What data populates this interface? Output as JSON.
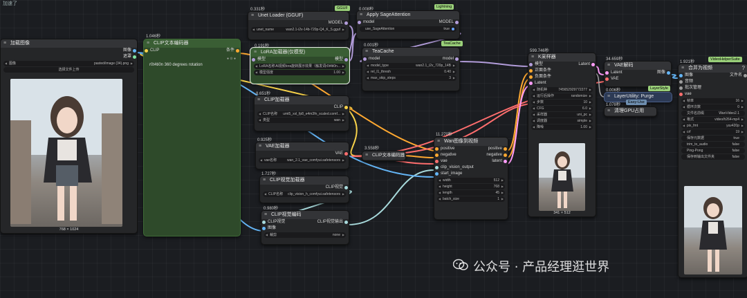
{
  "top_left_text": "加速了",
  "colors": {
    "clip": "#f7d24a",
    "model": "#b39ddb",
    "vae": "#ff6e6e",
    "conditioning": "#ffa931",
    "image": "#64b5f6",
    "latent": "#ff9cf9",
    "clip_vision": "#a8dadc"
  },
  "load_image": {
    "title": "加载图像",
    "out_image": "图像",
    "out_mask": "遮罩",
    "image_label": "图像",
    "image_value": "pasted/image (34).png",
    "upload": "选择文件上传",
    "size": "768 × 1024"
  },
  "clip_text_1": {
    "time": "1.046秒",
    "title": "CLIP文本编码器",
    "in_clip": "CLIP",
    "out_cond": "条件",
    "text": "r0t4ti0n 360 degrees rotation"
  },
  "unet_loader": {
    "time": "0.331秒",
    "tag": "GGUF",
    "title": "Unet Loader (GGUF)",
    "out_model": "MODEL",
    "w_label": "unet_name",
    "w_value": "wan2.1-i2v-14b-720p-Q4_K_S.gguf"
  },
  "lora_loader": {
    "time": "0.191秒",
    "title": "LoRA加载器(仅模型)",
    "in_model": "模型",
    "out_model": "模型",
    "w1_label": "LoRA名称",
    "w1_value": "AI视频lora旋转展示效果（触发词r0t4ti0n...",
    "w2_label": "模型强度",
    "w2_value": "1.00"
  },
  "sage": {
    "time": "0.008秒",
    "tag": "Lightning",
    "title": "Apply SageAttention",
    "in_model": "model",
    "out_model": "MODEL",
    "w_label": "use_SageAttention",
    "w_value": "true"
  },
  "teacache": {
    "time": "0.001秒",
    "tag": "TeaCache",
    "title": "TeaCache",
    "in_model": "model",
    "out_model": "model",
    "w1_label": "model_type",
    "w1_value": "wan2.1_i2v_720p_14B",
    "w2_label": "rel_l1_thresh",
    "w2_value": "0.40",
    "w3_label": "max_skip_steps",
    "w3_value": "3"
  },
  "clip_loader": {
    "time": "8.651秒",
    "title": "CLIP加载器",
    "out_clip": "CLIP",
    "w1_label": "CLIP名称",
    "w1_value": "umt5_xxl_fp8_e4m3fn_scaled.comf...",
    "w2_label": "类型",
    "w2_value": "wan"
  },
  "vae_loader": {
    "time": "0.925秒",
    "title": "VAE加载器",
    "out_vae": "VAE",
    "w_label": "vae名称",
    "w_value": "wan_2.1_vae_comfyui.safetensors"
  },
  "clip_vision_loader": {
    "time": "1.727秒",
    "title": "CLIP视觉加载器",
    "out": "CLIP视觉",
    "w_label": "CLIP名称",
    "w_value": "clip_vision_h_comfyui.safetensors"
  },
  "clip_vision_encode": {
    "time": "0.980秒",
    "title": "CLIP视觉编码",
    "in_clip": "CLIP视觉",
    "in_image": "图像",
    "out": "CLIP视觉输出",
    "w_label": "裁剪",
    "w_value": "none"
  },
  "clip_text_2": {
    "time": "3.558秒",
    "title": "CLIP文本编码器"
  },
  "wan_i2v": {
    "time": "11.270秒",
    "title": "Wan图像到视频",
    "in_pos": "positive",
    "in_neg": "negative",
    "in_vae": "vae",
    "in_clip": "clip_vision_output",
    "in_start": "start_image",
    "out_pos": "positive",
    "out_neg": "negative",
    "out_latent": "latent",
    "w1_label": "width",
    "w1_value": "512",
    "w2_label": "height",
    "w2_value": "768",
    "w3_label": "length",
    "w3_value": "45",
    "w4_label": "batch_size",
    "w4_value": "1"
  },
  "ksampler": {
    "time": "599.746秒",
    "title": "K采样器",
    "in_model": "模型",
    "in_pos": "正面条件",
    "in_neg": "负面条件",
    "in_latent": "Latent",
    "out_latent": "Latent",
    "w1_label": "随机种",
    "w1_value": "745652929772277",
    "w2_label": "运行后操作",
    "w2_value": "randomize",
    "w3_label": "步数",
    "w3_value": "10",
    "w4_label": "CFG",
    "w4_value": "6.0",
    "w5_label": "采样器",
    "w5_value": "uni_pc",
    "w6_label": "调度器",
    "w6_value": "simple",
    "w7_label": "降噪",
    "w7_value": "1.00",
    "size": "341 × 512"
  },
  "vae_decode": {
    "time": "34.659秒",
    "title": "VAE解码",
    "in_latent": "Latent",
    "in_vae": "VAE",
    "out": "图像"
  },
  "layer_utility": {
    "time": "0.006秒",
    "tag": "LayerStyle",
    "title": "LayerUtility: Purge",
    "tag2": "Easy-Use",
    "time2": "1.078秒",
    "title2": "清理GPU占用"
  },
  "video_combine": {
    "time": "1.921秒",
    "tag": "VideoHelperSuite",
    "title": "合并为视频",
    "in1": "图像",
    "in2": "音频",
    "in3": "批次管理",
    "in4": "vae",
    "out": "文件名",
    "w1_label": "帧率",
    "w1_value": "16",
    "w2_label": "循环次数",
    "w2_value": "0",
    "w3_label": "文件名前缀",
    "w3_value": "WanVideo2.1",
    "w4_label": "格式",
    "w4_value": "video/h264-mp4",
    "w5_label": "pix_fmt",
    "w5_value": "yuv420p",
    "w6_label": "crf",
    "w6_value": "19",
    "w7_label": "保存元数据",
    "w7_value": "true",
    "w8_label": "trim_to_audio",
    "w8_value": "false",
    "w9_label": "Ping-Pong",
    "w9_value": "false",
    "w10_label": "保存到输出文件夹",
    "w10_value": "false"
  },
  "watermark": "公众号 · 产品经理逛世界"
}
